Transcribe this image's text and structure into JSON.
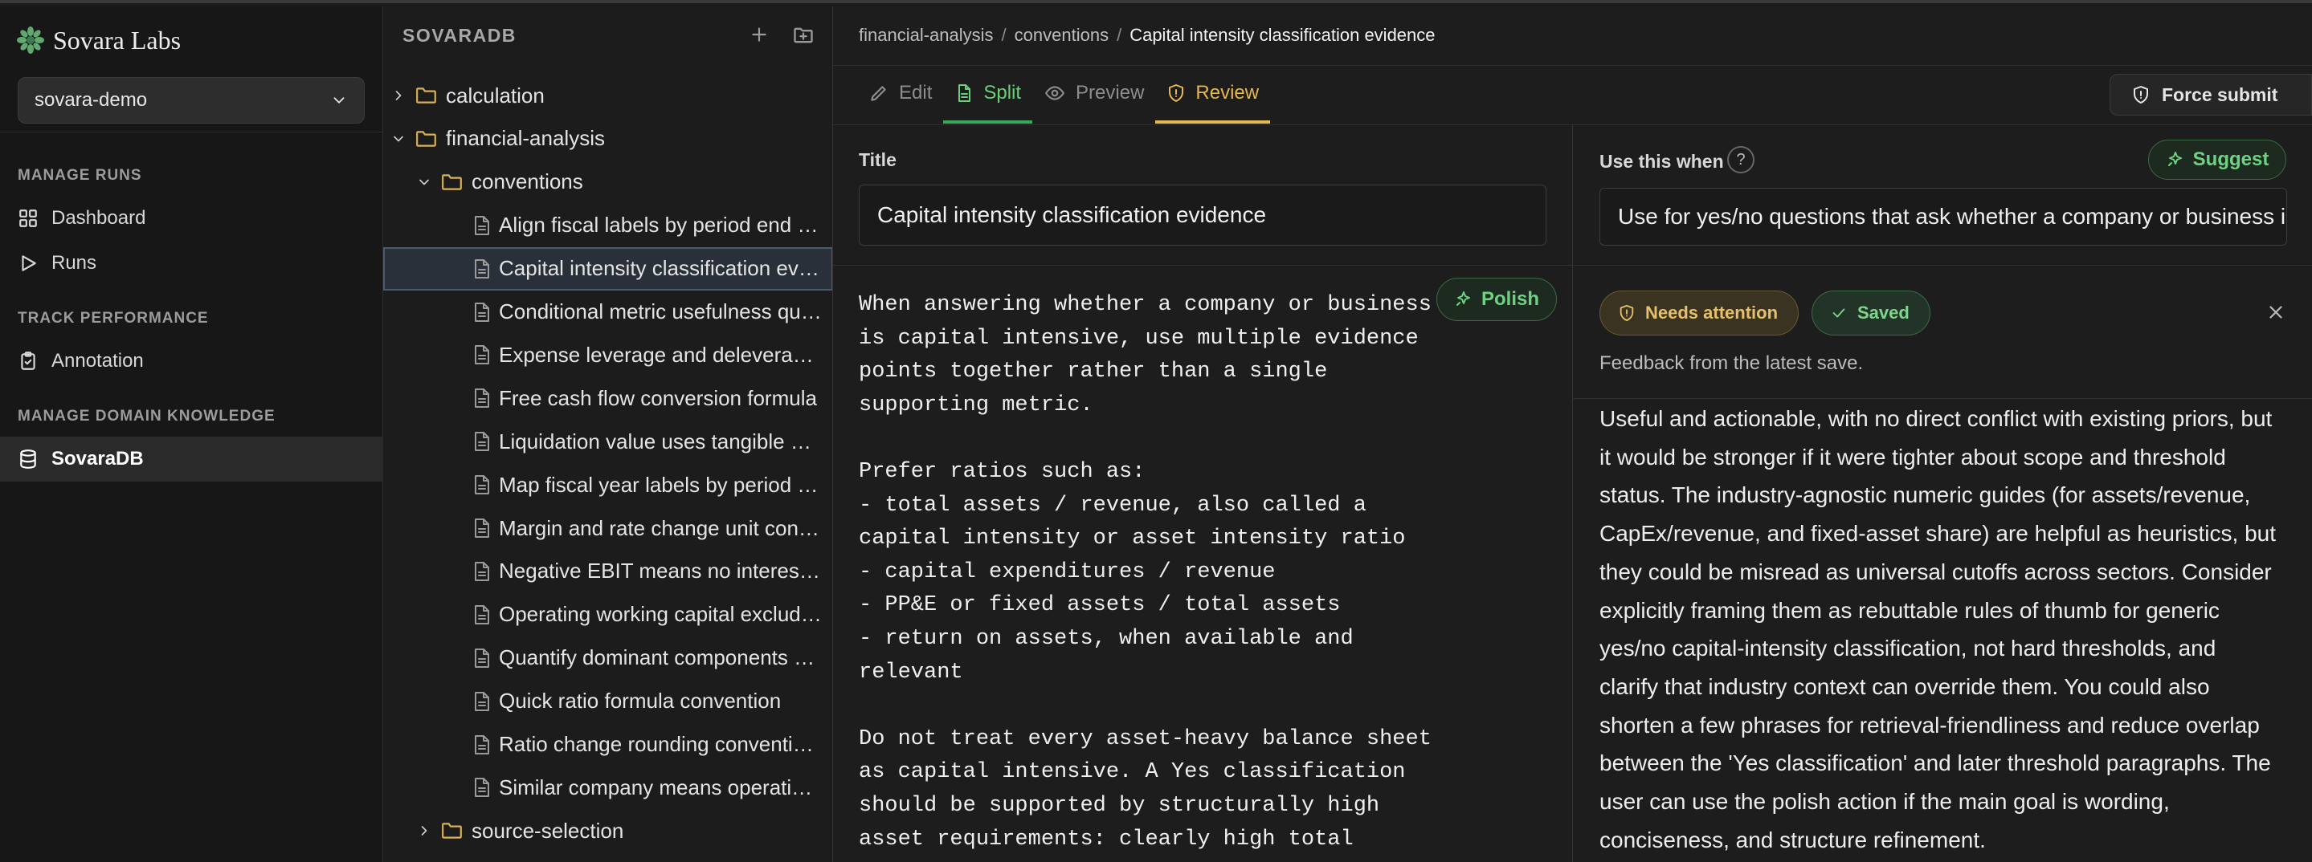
{
  "brand": {
    "name": "Sovara Labs",
    "logo_icon": "sunburst-logo-icon"
  },
  "workspace": {
    "selected": "sovara-demo"
  },
  "sidebar": {
    "sections": [
      {
        "title": "MANAGE RUNS",
        "items": [
          {
            "label": "Dashboard",
            "icon": "grid-icon"
          },
          {
            "label": "Runs",
            "icon": "play-icon"
          }
        ]
      },
      {
        "title": "TRACK PERFORMANCE",
        "items": [
          {
            "label": "Annotation",
            "icon": "clipboard-icon"
          }
        ]
      },
      {
        "title": "MANAGE DOMAIN KNOWLEDGE",
        "items": [
          {
            "label": "SovaraDB",
            "icon": "database-icon",
            "active": true
          }
        ]
      }
    ]
  },
  "tree": {
    "title": "SOVARADB",
    "nodes": [
      {
        "label": "calculation",
        "type": "folder",
        "expanded": false
      },
      {
        "label": "financial-analysis",
        "type": "folder",
        "expanded": true
      },
      {
        "label": "conventions",
        "type": "folder",
        "expanded": true
      },
      {
        "label": "Align fiscal labels by period end dates",
        "type": "file"
      },
      {
        "label": "Capital intensity classification evidence",
        "type": "file",
        "selected": true
      },
      {
        "label": "Conditional metric usefulness questions",
        "type": "file"
      },
      {
        "label": "Expense leverage and deleveraging",
        "type": "file"
      },
      {
        "label": "Free cash flow conversion formula",
        "type": "file"
      },
      {
        "label": "Liquidation value uses tangible assets",
        "type": "file"
      },
      {
        "label": "Map fiscal year labels by period end",
        "type": "file"
      },
      {
        "label": "Margin and rate change unit conventions",
        "type": "file"
      },
      {
        "label": "Negative EBIT means no interest coverage",
        "type": "file"
      },
      {
        "label": "Operating working capital excludes cash",
        "type": "file"
      },
      {
        "label": "Quantify dominant components of change",
        "type": "file"
      },
      {
        "label": "Quick ratio formula convention",
        "type": "file"
      },
      {
        "label": "Ratio change rounding conventions",
        "type": "file"
      },
      {
        "label": "Similar company means operating peers",
        "type": "file"
      },
      {
        "label": "source-selection",
        "type": "folder",
        "expanded": false
      }
    ]
  },
  "breadcrumb": [
    "financial-analysis",
    "conventions",
    "Capital intensity classification evidence"
  ],
  "tabs": [
    {
      "label": "Edit",
      "icon": "pencil-icon"
    },
    {
      "label": "Split",
      "icon": "document-icon",
      "active": true
    },
    {
      "label": "Preview",
      "icon": "eye-icon"
    },
    {
      "label": "Review",
      "icon": "shield-icon",
      "active": true
    }
  ],
  "force_submit": "Force submit",
  "editor": {
    "title_label": "Title",
    "title_value": "Capital intensity classification evidence",
    "polish_label": "Polish",
    "body": "When answering whether a company or business\nis capital intensive, use multiple evidence\npoints together rather than a single\nsupporting metric.\n\nPrefer ratios such as:\n- total assets / revenue, also called a\ncapital intensity or asset intensity ratio\n- capital expenditures / revenue\n- PP&E or fixed assets / total assets\n- return on assets, when available and\nrelevant\n\nDo not treat every asset-heavy balance sheet\nas capital intensive. A Yes classification\nshould be supported by structurally high\nasset requirements: clearly high total"
  },
  "use_when": {
    "label": "Use this when",
    "help": "?",
    "suggest_label": "Suggest",
    "value": "Use for yes/no questions that ask whether a company or business is capital intensive"
  },
  "review": {
    "status_badge": "Needs attention",
    "saved_badge": "Saved",
    "feedback_title": "Feedback from the latest save.",
    "feedback_lines": [
      "Useful and actionable, with no direct conflict with existing priors, but",
      "it would be stronger if it were tighter about scope and threshold",
      "status. The industry-agnostic numeric guides (for assets/revenue,",
      "CapEx/revenue, and fixed-asset share) are helpful as heuristics, but",
      "they could be misread as universal cutoffs across sectors. Consider",
      "explicitly framing them as rebuttable rules of thumb for generic",
      "yes/no capital-intensity classification, not hard thresholds, and",
      "clarify that industry context can override them. You could also",
      "shorten a few phrases for retrieval-friendliness and reduce overlap",
      "between the 'Yes classification' and later threshold paragraphs. The",
      "user can use the polish action if the main goal is wording,",
      "conciseness, and structure refinement."
    ]
  },
  "colors": {
    "accent_green": "#6bcf7a",
    "accent_yellow": "#e4b84f",
    "folder": "#d8b25a",
    "background": "#1d1d1d"
  }
}
